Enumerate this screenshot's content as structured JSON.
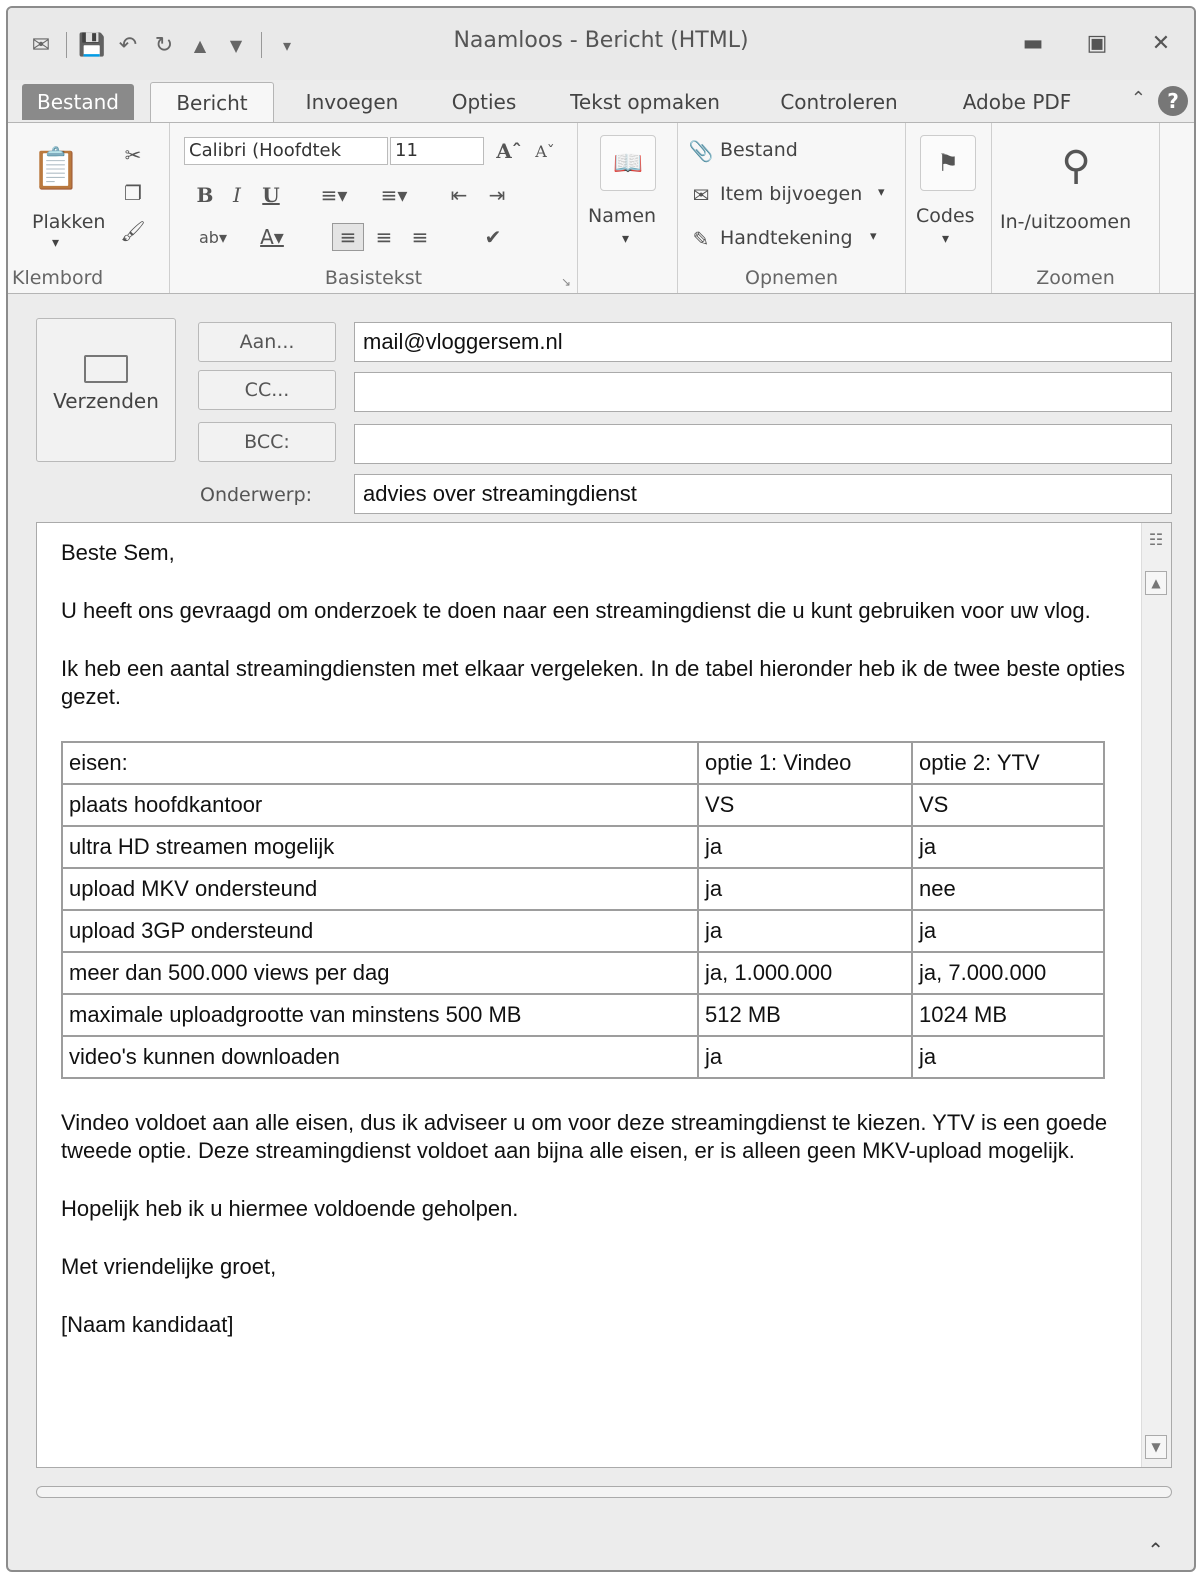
{
  "window": {
    "title": "Naamloos - Bericht (HTML)"
  },
  "tabs": [
    {
      "label": "Bestand"
    },
    {
      "label": "Bericht"
    },
    {
      "label": "Invoegen"
    },
    {
      "label": "Opties"
    },
    {
      "label": "Tekst opmaken"
    },
    {
      "label": "Controleren"
    },
    {
      "label": "Adobe PDF"
    }
  ],
  "ribbon": {
    "clipboard": {
      "paste_label": "Plakken",
      "group_label": "Klembord"
    },
    "font": {
      "font_name": "Calibri (Hoofdtek",
      "font_size": "11",
      "group_label": "Basistekst"
    },
    "names": {
      "label": "Namen"
    },
    "include": {
      "file": "Bestand",
      "attach_item": "Item bijvoegen",
      "signature": "Handtekening",
      "group_label": "Opnemen"
    },
    "tags": {
      "label": "Codes"
    },
    "zoom": {
      "label": "In-/uitzoomen",
      "group_label": "Zoomen"
    }
  },
  "header": {
    "send_label": "Verzenden",
    "to_label": "Aan...",
    "cc_label": "CC...",
    "bcc_label": "BCC:",
    "subject_label": "Onderwerp:",
    "to_value": "mail@vloggersem.nl",
    "cc_value": "",
    "bcc_value": "",
    "subject_value": "advies over streamingdienst"
  },
  "body": {
    "greeting": "Beste Sem,",
    "para1": "U heeft ons gevraagd om onderzoek te doen naar een streamingdienst die u kunt gebruiken voor uw vlog.",
    "para2": "Ik heb een aantal streamingdiensten met elkaar vergeleken. In de tabel hieronder heb ik de twee beste opties gezet.",
    "table": [
      [
        "eisen:",
        "optie 1: Vindeo",
        "optie 2: YTV"
      ],
      [
        "plaats hoofdkantoor",
        "VS",
        "VS"
      ],
      [
        "ultra HD streamen mogelijk",
        "ja",
        "ja"
      ],
      [
        "upload MKV ondersteund",
        "ja",
        "nee"
      ],
      [
        "upload 3GP ondersteund",
        "ja",
        "ja"
      ],
      [
        "meer dan 500.000 views per dag",
        "ja, 1.000.000",
        "ja, 7.000.000"
      ],
      [
        "maximale uploadgrootte van minstens 500 MB",
        "512 MB",
        "1024 MB"
      ],
      [
        "video's kunnen downloaden",
        "ja",
        "ja"
      ]
    ],
    "para3": "Vindeo voldoet aan alle eisen, dus ik adviseer u om voor deze streamingdienst te kiezen. YTV is een goede tweede optie. Deze streamingdienst voldoet aan bijna alle eisen, er is alleen geen MKV-upload mogelijk.",
    "para4": "Hopelijk heb ik u hiermee voldoende geholpen.",
    "closing": "Met vriendelijke groet,",
    "signature": "[Naam kandidaat]"
  }
}
